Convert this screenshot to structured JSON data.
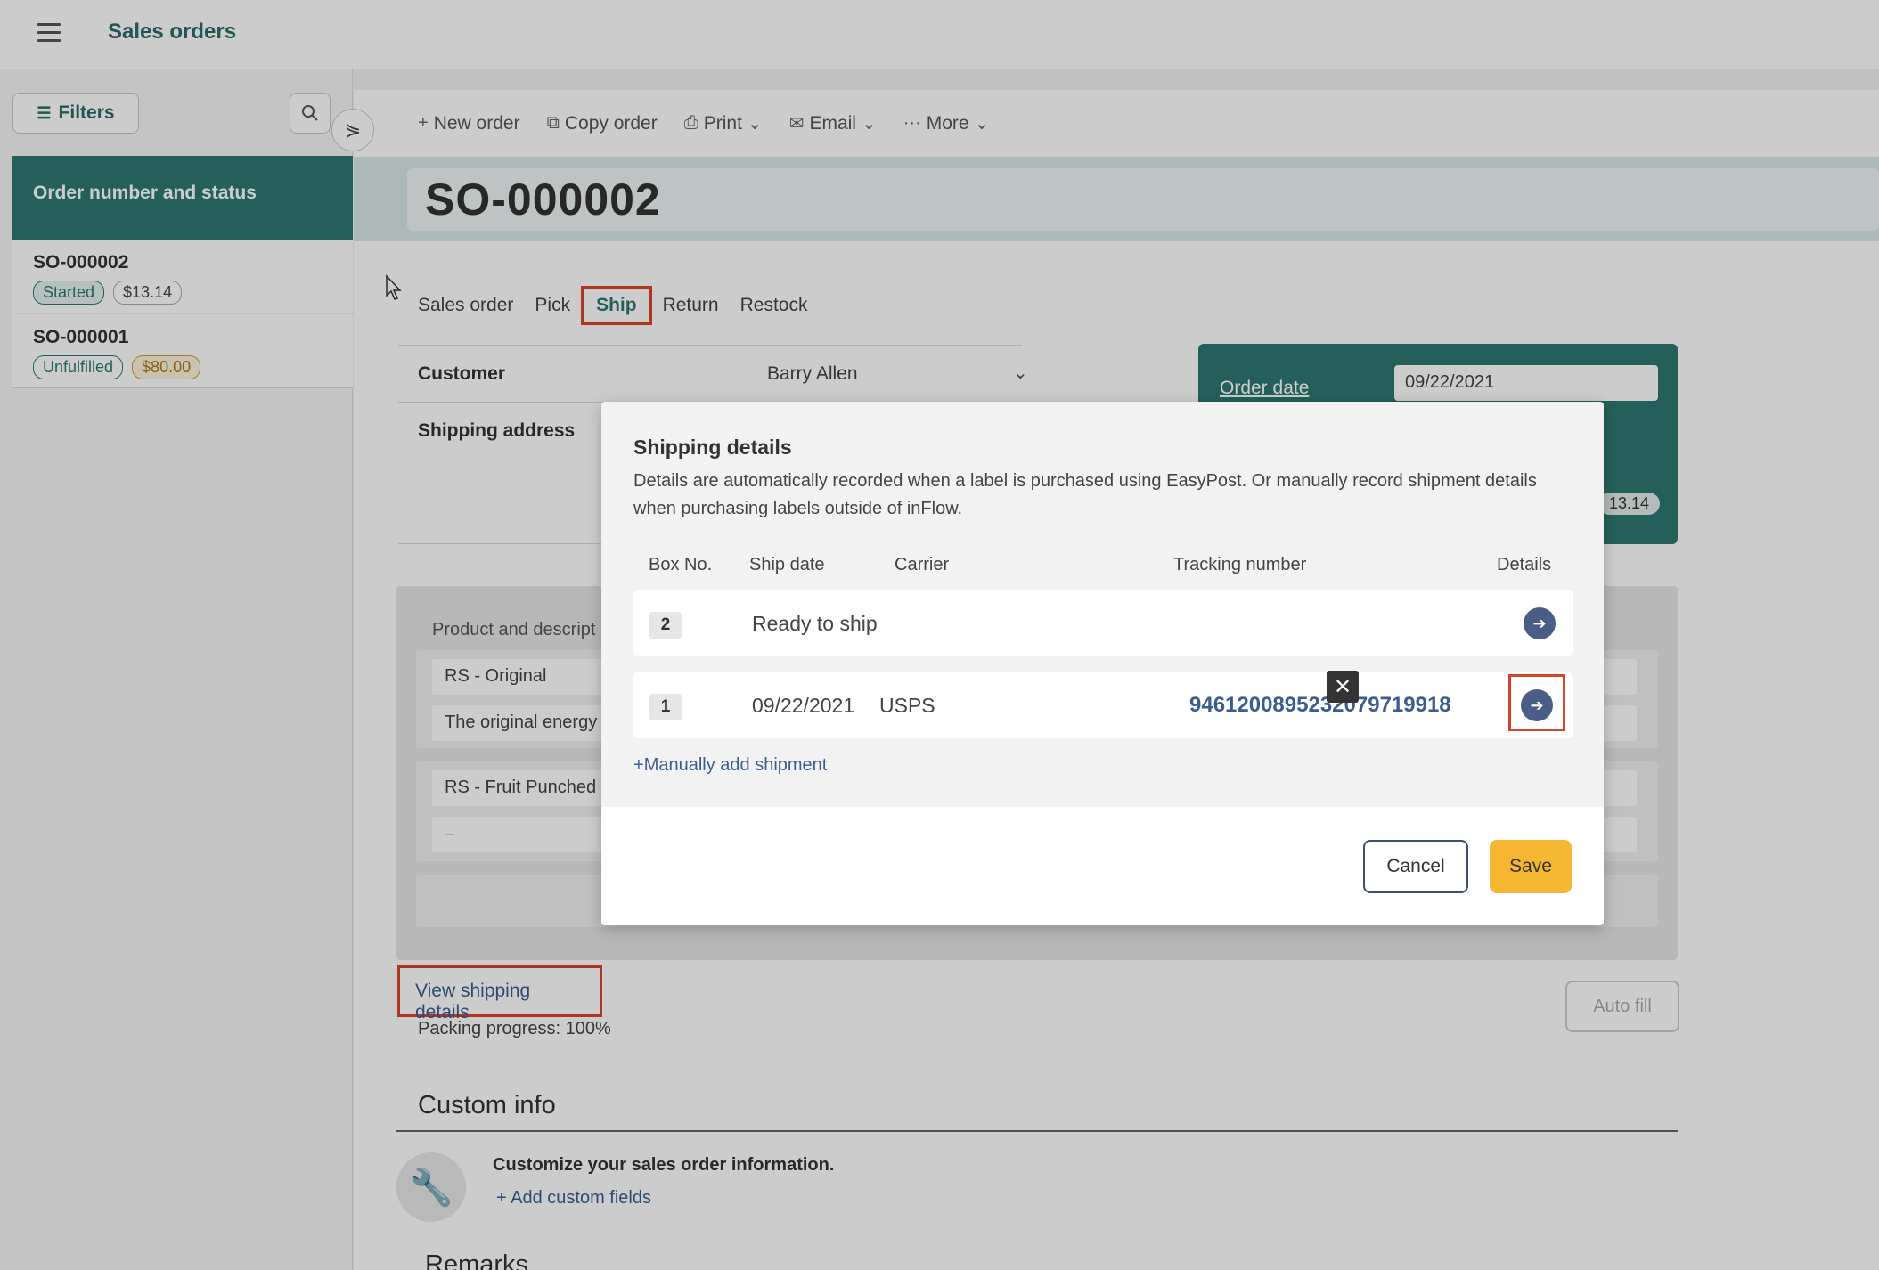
{
  "app": {
    "title": "Sales orders"
  },
  "sidebar": {
    "filters_label": "Filters",
    "list_header": "Order number and status",
    "orders": [
      {
        "number": "SO-000002",
        "status": "Started",
        "amount": "$13.14"
      },
      {
        "number": "SO-000001",
        "status": "Unfulfilled",
        "amount": "$80.00"
      }
    ]
  },
  "toolbar": {
    "new_order": "New order",
    "copy_order": "Copy order",
    "print": "Print",
    "email": "Email",
    "more": "More"
  },
  "order": {
    "number": "SO-000002",
    "tabs": [
      "Sales order",
      "Pick",
      "Ship",
      "Return",
      "Restock"
    ],
    "active_tab": "Ship",
    "customer_label": "Customer",
    "customer_value": "Barry Allen",
    "shipping_address_label": "Shipping address",
    "order_date_label": "Order date",
    "order_date_value": "09/22/2021",
    "total_fragment": "13.14"
  },
  "products": {
    "header": "Product and descript",
    "items": [
      {
        "name": "RS - Original",
        "description": "The original energy"
      },
      {
        "name": "RS - Fruit Punched",
        "description": "–"
      }
    ]
  },
  "shipping": {
    "view_details": "View shipping details",
    "packing_progress": "Packing progress: 100%",
    "auto_fill": "Auto fill"
  },
  "custom_info": {
    "title": "Custom info",
    "prompt": "Customize your sales order information.",
    "add_link": "Add custom fields"
  },
  "remarks_title": "Remarks",
  "modal": {
    "title": "Shipping details",
    "description": "Details are automatically recorded when a label is purchased using EasyPost. Or manually record shipment details when purchasing labels outside of inFlow.",
    "columns": {
      "box_no": "Box No.",
      "ship_date": "Ship date",
      "carrier": "Carrier",
      "tracking": "Tracking number",
      "details": "Details"
    },
    "rows": [
      {
        "box": "2",
        "status": "Ready to ship"
      },
      {
        "box": "1",
        "ship_date": "09/22/2021",
        "carrier": "USPS",
        "tracking": "9461200895232079719918"
      }
    ],
    "manual_add": "Manually add shipment",
    "cancel": "Cancel",
    "save": "Save"
  },
  "colors": {
    "teal": "#2e7870",
    "highlight": "#d9432a",
    "save": "#f5b731",
    "link": "#3b5d8e"
  }
}
